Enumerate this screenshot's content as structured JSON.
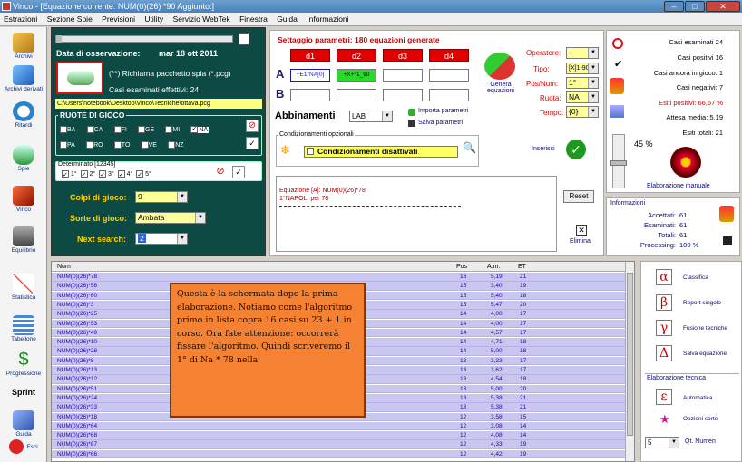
{
  "title": "Vinco - [Equazione corrente: NUM(0)(26) *90 Aggiunto:]",
  "menu": [
    "Estrazioni",
    "Sezione Spie",
    "Previsioni",
    "Utility",
    "Servizio WebTek",
    "Finestra",
    "Guida",
    "Informazioni"
  ],
  "sidebar": [
    "Archivi",
    "Archivi derivati",
    "Ritardi",
    "Spie",
    "Vinco",
    "Equilibrio",
    "Statistica",
    "Tabellone",
    "Progressione",
    "Sprint",
    "Guida",
    "Esci"
  ],
  "obs": {
    "date_label": "Data di osservazione:",
    "date": "mar 18 ott 2011",
    "pkg": "(**) Richiama pacchetto spia (*.pcg)",
    "cases": "Casi esaminati effettivi: 24",
    "path": "C:\\Users\\notebook\\Desktop\\Vinco\\Tecniche\\ottava.pcg"
  },
  "ruote": {
    "title": "RUOTE DI GIOCO",
    "labels": [
      "BA",
      "CA",
      "FI",
      "GE",
      "MI",
      "NA",
      "PA",
      "RO",
      "TO",
      "VE",
      "NZ"
    ],
    "checked": "NA"
  },
  "determinato": {
    "title": "Determinato [12345]",
    "items": [
      "1°",
      "2°",
      "3°",
      "4°",
      "5°"
    ]
  },
  "colpi": {
    "label": "Colpi di gioco:",
    "value": "9"
  },
  "sorte": {
    "label": "Sorte di gioco:",
    "value": "Ambata"
  },
  "next": {
    "label": "Next search:",
    "value": "2"
  },
  "params": {
    "title": "Settaggio parametri: 180 equazioni generate",
    "d": [
      "d1",
      "d2",
      "d3",
      "d4"
    ],
    "a_cells": [
      "+E1°NA[0]",
      "+X+°1_90",
      "",
      ""
    ],
    "genera": "Genera equazioni",
    "abbinamenti": "Abbinamenti",
    "lab": "LAB",
    "importa": "Importa parametri",
    "salva": "Salva parametri",
    "cond_title": "Condizionamenti opzionali",
    "cond": "Condizionamenti disattivati",
    "inserisci": "Inserisci",
    "operatore": {
      "label": "Operatore:",
      "value": "+"
    },
    "tipo": {
      "label": "Tipo:",
      "value": "[X]1-90"
    },
    "pos": {
      "label": "Pos/Num:",
      "value": "1°"
    },
    "ruota": {
      "label": "Ruota:",
      "value": "NA"
    },
    "tempo": {
      "label": "Tempo:",
      "value": "{0}"
    }
  },
  "equation": {
    "line1": "Equazione [A]: NUM(0)(26)*78",
    "line2": "1°NAPOLI  per 78",
    "reset": "Reset",
    "elimina": "Elimina"
  },
  "stats": {
    "esaminati": "Casi esaminati 24",
    "positivi": "Casi positivi 16",
    "in_gioco": "Casi ancora in gioco: 1",
    "negativi": "Casi negativi: 7",
    "esiti_pos": "Esiti positivi: 66,67 %",
    "attesa": "Attesa media: 5,19",
    "esiti_tot": "Esiti totali: 21",
    "pct": "45 %",
    "elab": "Elaborazione manuale"
  },
  "informazioni": {
    "title": "Informazioni",
    "rows": [
      [
        "Accettati:",
        "61"
      ],
      [
        "Esaminati:",
        "61"
      ],
      [
        "Totali:",
        "61"
      ],
      [
        "Processing:",
        "100 %"
      ]
    ]
  },
  "table": {
    "headers": [
      "Num",
      "Pos",
      "A.m.",
      "ET"
    ],
    "rows": [
      [
        "NUM(0)(26)*78",
        "16",
        "5,19",
        "21"
      ],
      [
        "NUM(0)(26)*58",
        "15",
        "3,40",
        "19"
      ],
      [
        "NUM(0)(26)*60",
        "15",
        "5,40",
        "18"
      ],
      [
        "NUM(0)(26)*3",
        "15",
        "5,47",
        "20"
      ],
      [
        "NUM(0)(26)*25",
        "14",
        "4,00",
        "17"
      ],
      [
        "NUM(0)(26)*53",
        "14",
        "4,00",
        "17"
      ],
      [
        "NUM(0)(26)*49",
        "14",
        "4,57",
        "17"
      ],
      [
        "NUM(0)(26)*10",
        "14",
        "4,71",
        "18"
      ],
      [
        "NUM(0)(26)*28",
        "14",
        "5,00",
        "18"
      ],
      [
        "NUM(0)(26)*8",
        "13",
        "3,23",
        "17"
      ],
      [
        "NUM(0)(26)*13",
        "13",
        "3,62",
        "17"
      ],
      [
        "NUM(0)(26)*12",
        "13",
        "4,54",
        "18"
      ],
      [
        "NUM(0)(26)*51",
        "13",
        "5,00",
        "20"
      ],
      [
        "NUM(0)(26)*24",
        "13",
        "5,38",
        "21"
      ],
      [
        "NUM(0)(26)*33",
        "13",
        "5,38",
        "21"
      ],
      [
        "NUM(0)(26)*18",
        "12",
        "3,58",
        "15"
      ],
      [
        "NUM(0)(26)*64",
        "12",
        "3,08",
        "14"
      ],
      [
        "NUM(0)(26)*68",
        "12",
        "4,08",
        "14"
      ],
      [
        "NUM(0)(26)*87",
        "12",
        "4,33",
        "19"
      ],
      [
        "NUM(0)(26)*66",
        "12",
        "4,42",
        "19"
      ]
    ]
  },
  "note": "Questa è la schermata dopo la prima elaborazione. Notiamo come l'algoritmo primo in lista copra 16 casi su 23 + 1 in corso. Ora fate attenzione: occorrerà fissare l'algoritmo. Quindi scriveremo il 1° di Na * 78 nella",
  "tools": {
    "classifica": "Classifica",
    "report": "Report singolo",
    "fusione": "Fusione tecniche",
    "salva": "Salva equazione",
    "elab_title": "Elaborazione tecnica",
    "automatica": "Automatica",
    "opzioni": "Opzioni sorte",
    "qt_value": "5",
    "qt_label": "Qt. Numeri"
  },
  "colors": {
    "green_panel": "#0c4a43",
    "row": "#c9c7f0",
    "note": "#f58232",
    "red": "#e00000"
  }
}
